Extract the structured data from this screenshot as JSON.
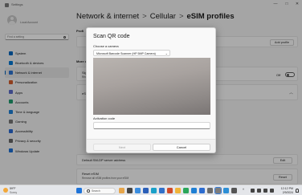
{
  "window": {
    "app_title": "Settings",
    "controls": {
      "minimize": "—",
      "maximize": "□",
      "close": "✕"
    }
  },
  "profile": {
    "name": "",
    "subtitle": "Local Account"
  },
  "search": {
    "placeholder": "Find a setting"
  },
  "sidebar": {
    "items": [
      {
        "label": "System",
        "icon": "monitor-icon",
        "color": "#0067c0"
      },
      {
        "label": "Bluetooth & devices",
        "icon": "bluetooth-icon",
        "color": "#0078d4"
      },
      {
        "label": "Network & internet",
        "icon": "wifi-icon",
        "color": "#2b73d2",
        "active": true
      },
      {
        "label": "Personalization",
        "icon": "brush-icon",
        "color": "#d35e2d"
      },
      {
        "label": "Apps",
        "icon": "apps-icon",
        "color": "#5a6cc9"
      },
      {
        "label": "Accounts",
        "icon": "person-icon",
        "color": "#1f9b6f"
      },
      {
        "label": "Time & language",
        "icon": "globe-clock-icon",
        "color": "#1c7fd6"
      },
      {
        "label": "Gaming",
        "icon": "gamepad-icon",
        "color": "#777777"
      },
      {
        "label": "Accessibility",
        "icon": "accessibility-icon",
        "color": "#2a6bd3"
      },
      {
        "label": "Privacy & security",
        "icon": "shield-icon",
        "color": "#666666"
      },
      {
        "label": "Windows Update",
        "icon": "update-icon",
        "color": "#1d6fd4"
      }
    ]
  },
  "breadcrumb": {
    "part1": "Network & internet",
    "sep1": ">",
    "part2": "Cellular",
    "sep2": ">",
    "current": "eSIM profiles"
  },
  "main": {
    "profiles_heading": "Profi",
    "add_profile_label": "Add profile",
    "more_heading": "More c",
    "row_sign": "Sign",
    "row_sign_sub": "Rec",
    "toggle_label": "Off",
    "esim_row": "eSIM",
    "default_server_label": "Default SM-DP server address",
    "edit_label": "Edit",
    "reset_label": "Reset eSIM",
    "reset_sub": "Remove all eSIM profiles from your eSIM",
    "reset_button": "Reset"
  },
  "dialog": {
    "title": "Scan QR code",
    "camera_label": "Choose a camera",
    "camera_selected": "Microsoft Barcode Scanner (HP 5MP Camera)",
    "activation_label": "Activation code",
    "activation_value": "",
    "next_label": "Next",
    "cancel_label": "Cancel"
  },
  "taskbar": {
    "temperature": "59°F",
    "condition": "Sunny",
    "search_placeholder": "Search",
    "time": "12:12 PM",
    "date": "2/9/2024",
    "tray_chevron": "^",
    "pinned_icons": [
      "start-icon",
      "taskview-icon",
      "app-icon",
      "app-icon",
      "app-icon",
      "edge-icon",
      "app-icon",
      "explorer-icon",
      "store-icon",
      "app-icon",
      "app-icon",
      "app-icon",
      "app-icon",
      "settings-icon",
      "app-icon",
      "app-icon"
    ]
  },
  "colors": {
    "accent": "#005fb8",
    "overlay": "rgba(0,0,0,0.32)"
  }
}
